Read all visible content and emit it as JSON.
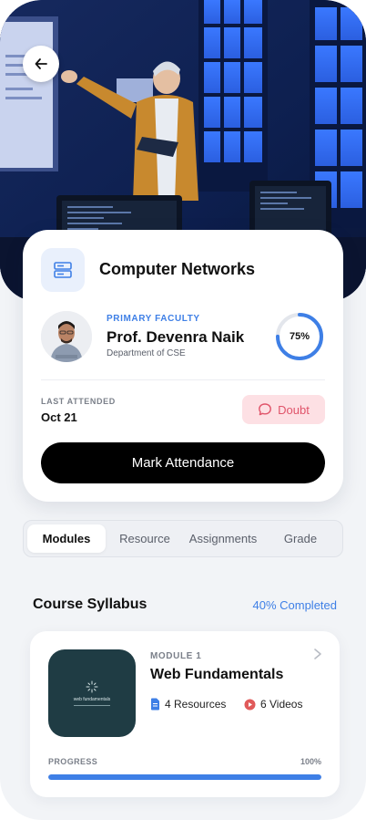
{
  "colors": {
    "accent": "#3e7fe6",
    "doubt": "#e0546a",
    "doubt_bg": "#fde0e4",
    "primary_button": "#000000"
  },
  "hero": {
    "back_icon": "arrow-left-icon"
  },
  "course": {
    "icon": "server-icon",
    "title": "Computer Networks",
    "faculty": {
      "role": "PRIMARY FACULTY",
      "name": "Prof. Devenra Naik",
      "department": "Department of CSE"
    },
    "attendance": {
      "percent": 75,
      "label": "75%"
    },
    "last_attended": {
      "label": "LAST ATTENDED",
      "value": "Oct 21"
    },
    "doubt_button": {
      "label": "Doubt",
      "icon": "chat-bubble-icon"
    },
    "mark_attendance_button": "Mark Attendance"
  },
  "tabs": [
    {
      "label": "Modules",
      "active": true
    },
    {
      "label": "Resource",
      "active": false
    },
    {
      "label": "Assignments",
      "active": false
    },
    {
      "label": "Grade",
      "active": false
    }
  ],
  "syllabus": {
    "title": "Course Syllabus",
    "progress_label": "40% Completed",
    "modules": [
      {
        "number": "MODULE 1",
        "title": "Web Fundamentals",
        "thumbnail_text": "web fundamentals",
        "resources": "4 Resources",
        "videos": "6 Videos",
        "progress_label": "PROGRESS",
        "progress_value": "100%",
        "progress_fraction": 1.0
      }
    ]
  }
}
